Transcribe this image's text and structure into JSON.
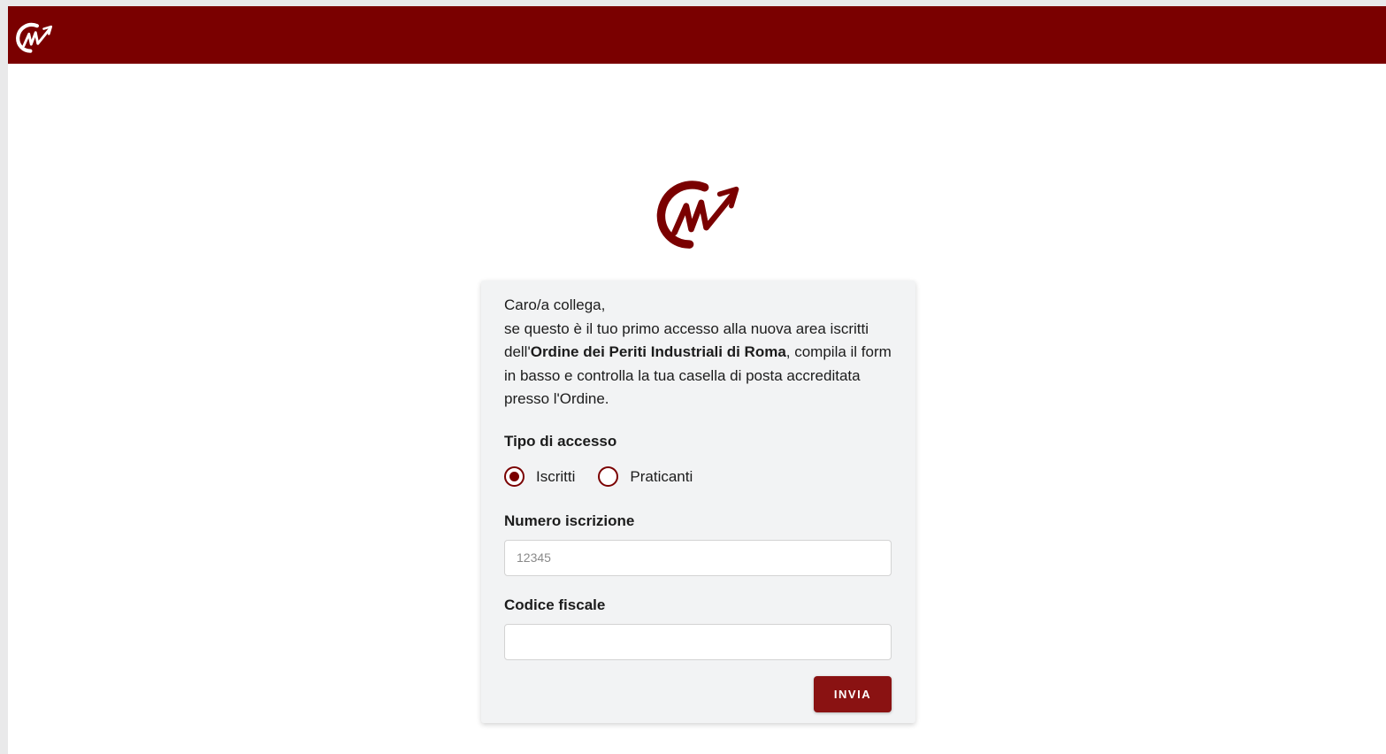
{
  "colors": {
    "brand": "#7a0000",
    "button": "#8a1212",
    "card_background": "#f2f3f4"
  },
  "header": {
    "logo_icon": "ordine-periti-logo-icon"
  },
  "main": {
    "logo_icon": "ordine-periti-logo-icon"
  },
  "form": {
    "greeting": "Caro/a collega,",
    "intro_before": "se questo è il tuo primo accesso alla nuova area iscritti dell'",
    "intro_bold": "Ordine dei Periti Industriali di Roma",
    "intro_after": ", compila il form in basso e controlla la tua casella di posta accreditata presso l'Ordine.",
    "tipo_accesso_label": "Tipo di accesso",
    "radio_options": [
      {
        "label": "Iscritti",
        "selected": true
      },
      {
        "label": "Praticanti",
        "selected": false
      }
    ],
    "numero_label": "Numero iscrizione",
    "numero_placeholder": "12345",
    "numero_value": "",
    "codice_label": "Codice fiscale",
    "codice_placeholder": "",
    "codice_value": "",
    "submit_label": "INVIA"
  }
}
